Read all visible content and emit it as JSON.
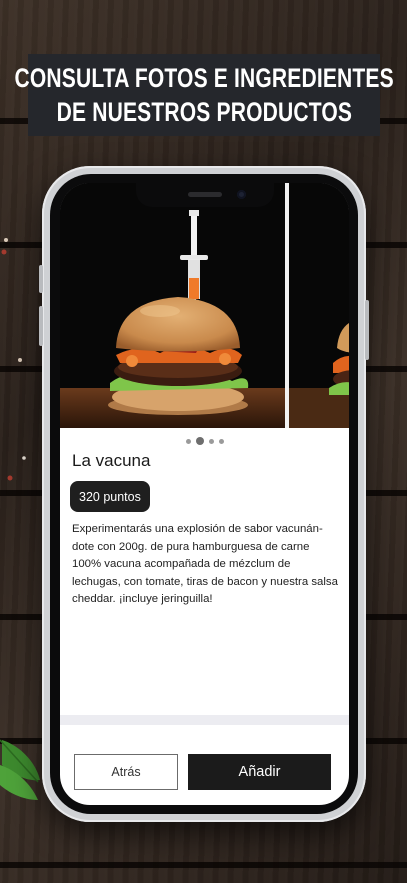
{
  "banner": {
    "line1": "CONSULTA FOTOS E INGREDIENTES",
    "line2": "DE NUESTROS PRODUCTOS"
  },
  "product": {
    "name": "La vacuna",
    "points": "320 puntos",
    "description": "Experimentarás una explosión de sabor vacunán-dote con 200g. de pura hamburguesa de carne 100% vacuna acompañada de mézclum de lechugas, con tomate, tiras de bacon y nuestra salsa cheddar. ¡incluye jeringuilla!"
  },
  "gallery": {
    "page_count": 4,
    "active_index": 1
  },
  "actions": {
    "back_label": "Atrás",
    "add_label": "Añadir"
  },
  "icons": {
    "image_main": "burger-photo",
    "image_next": "burger-photo-preview"
  },
  "colors": {
    "banner_bg": "#25272c",
    "button_dark": "#1b1b1b",
    "points_badge": "#1f1f1f"
  }
}
